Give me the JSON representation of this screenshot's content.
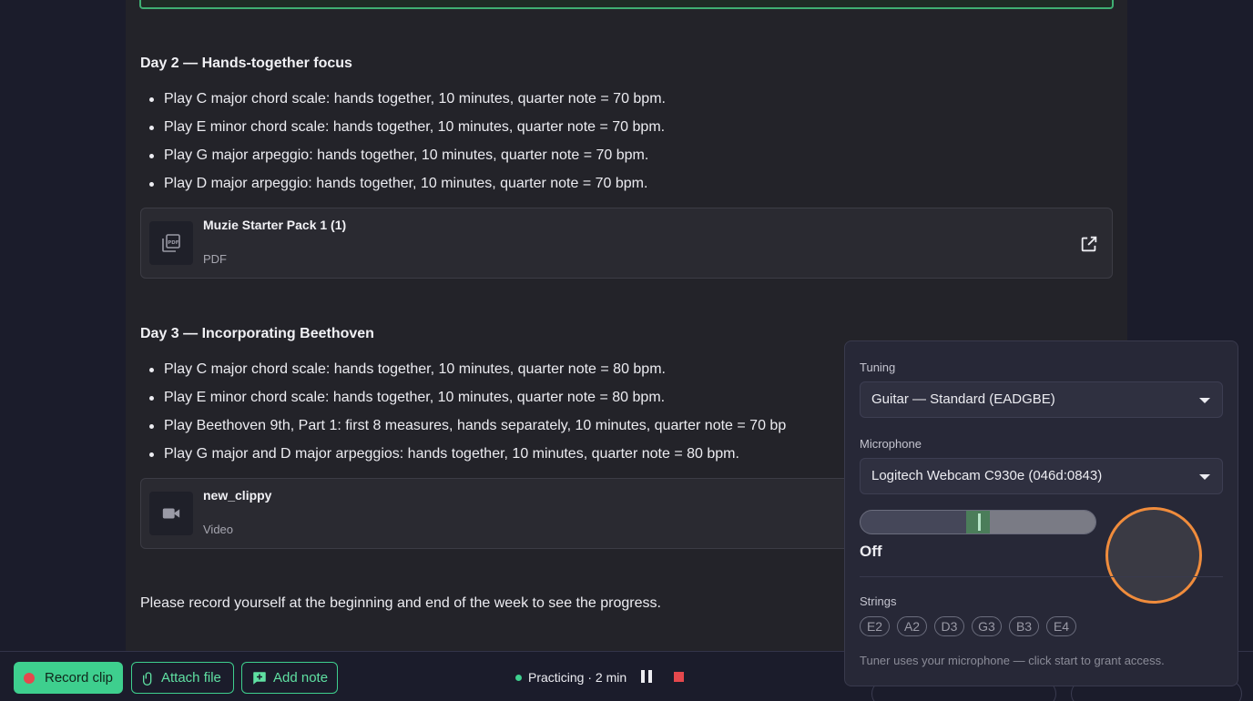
{
  "document": {
    "day2": {
      "title": "Day 2 — Hands-together focus",
      "tasks": [
        "Play C major chord scale: hands together, 10 minutes, quarter note = 70 bpm.",
        "Play E minor chord scale: hands together, 10 minutes, quarter note = 70 bpm.",
        "Play G major arpeggio: hands together, 10 minutes, quarter note = 70 bpm.",
        "Play D major arpeggio: hands together, 10 minutes, quarter note = 70 bpm."
      ],
      "attachment": {
        "name": "Muzie Starter Pack 1 (1)",
        "kind": "PDF",
        "icon": "pdf-icon"
      }
    },
    "day3": {
      "title": "Day 3 — Incorporating Beethoven",
      "tasks": [
        "Play C major chord scale: hands together, 10 minutes, quarter note = 80 bpm.",
        "Play E minor chord scale: hands together, 10 minutes, quarter note = 80 bpm.",
        "Play Beethoven 9th, Part 1: first 8 measures, hands separately, 10 minutes, quarter note = 70 bp",
        "Play G major and D major arpeggios: hands together, 10 minutes, quarter note = 80 bpm."
      ],
      "attachment": {
        "name": "new_clippy",
        "kind": "Video",
        "icon": "video-camera-icon"
      }
    },
    "closing": "Please record yourself at the beginning and end of the week to see the progress."
  },
  "toolbar": {
    "record_label": "Record clip",
    "attach_label": "Attach file",
    "note_label": "Add note",
    "status": "Practicing · 2 min"
  },
  "tuner": {
    "tuning_label": "Tuning",
    "tuning_value": "Guitar — Standard (EADGBE)",
    "mic_label": "Microphone",
    "mic_value": "Logitech Webcam C930e (046d:0843)",
    "meter_state": "Off",
    "strings_label": "Strings",
    "strings": [
      "E2",
      "A2",
      "D3",
      "G3",
      "B3",
      "E4"
    ],
    "hint": "Tuner uses your microphone — click start to grant access."
  },
  "colors": {
    "accent": "#3ecf8e",
    "record": "#e5484d",
    "ring": "#f08c3c"
  }
}
